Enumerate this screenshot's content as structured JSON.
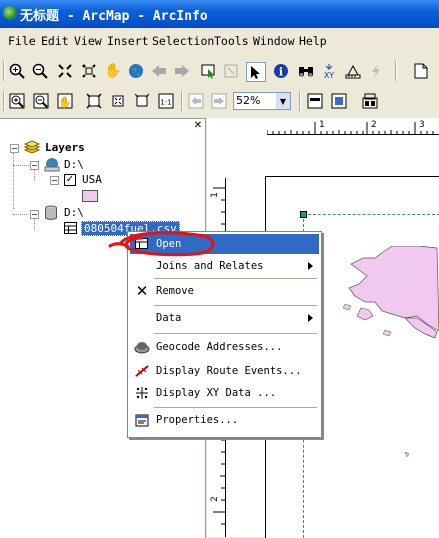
{
  "window": {
    "title": "无标题 - ArcMap - ArcInfo"
  },
  "menubar": {
    "items": [
      "File",
      "Edit",
      "View",
      "Insert",
      "Selection",
      "Tools",
      "Window",
      "Help"
    ]
  },
  "toolbar2": {
    "zoom_value": "52%"
  },
  "toc": {
    "root_label": "Layers",
    "frame1_label": "D:\\",
    "layer_usa": "USA",
    "frame2_label": "D:\\",
    "table_label": "080504fuel.csv"
  },
  "ruler": {
    "top": [
      "1",
      "2",
      "3"
    ],
    "left": [
      "1",
      "2"
    ]
  },
  "context_menu": {
    "open": "Open",
    "joins": "Joins and Relates",
    "remove": "Remove",
    "data": "Data",
    "geocode": "Geocode Addresses...",
    "route": "Display Route Events...",
    "xy": "Display XY Data ...",
    "properties": "Properties..."
  },
  "colors": {
    "titlebar": "#0a5fd8",
    "selection": "#316ac5",
    "usa_fill": "#f0c8f0",
    "annotation": "#e81010"
  },
  "icons": {
    "toolbar1": [
      "zoom-in-icon",
      "zoom-out-icon",
      "fixed-zoom-in-icon",
      "fixed-zoom-out-icon",
      "pan-hand-icon",
      "full-extent-globe-icon",
      "back-arrow-icon",
      "forward-arrow-icon",
      "select-features-icon",
      "clear-selection-icon",
      "select-elements-icon",
      "identify-icon",
      "find-icon",
      "go-to-xy-icon",
      "measure-icon",
      "hyperlink-icon",
      "new-document-icon"
    ],
    "toolbar2": [
      "layout-zoom-in-icon",
      "layout-zoom-out-icon",
      "layout-pan-icon",
      "zoom-whole-page-icon",
      "zoom-fixed-in-icon",
      "zoom-fixed-out-icon",
      "zoom-100-icon",
      "go-back-extent-icon",
      "go-forward-extent-icon",
      "toggle-draft-mode-icon",
      "focus-data-frame-icon",
      "change-layout-icon"
    ]
  }
}
